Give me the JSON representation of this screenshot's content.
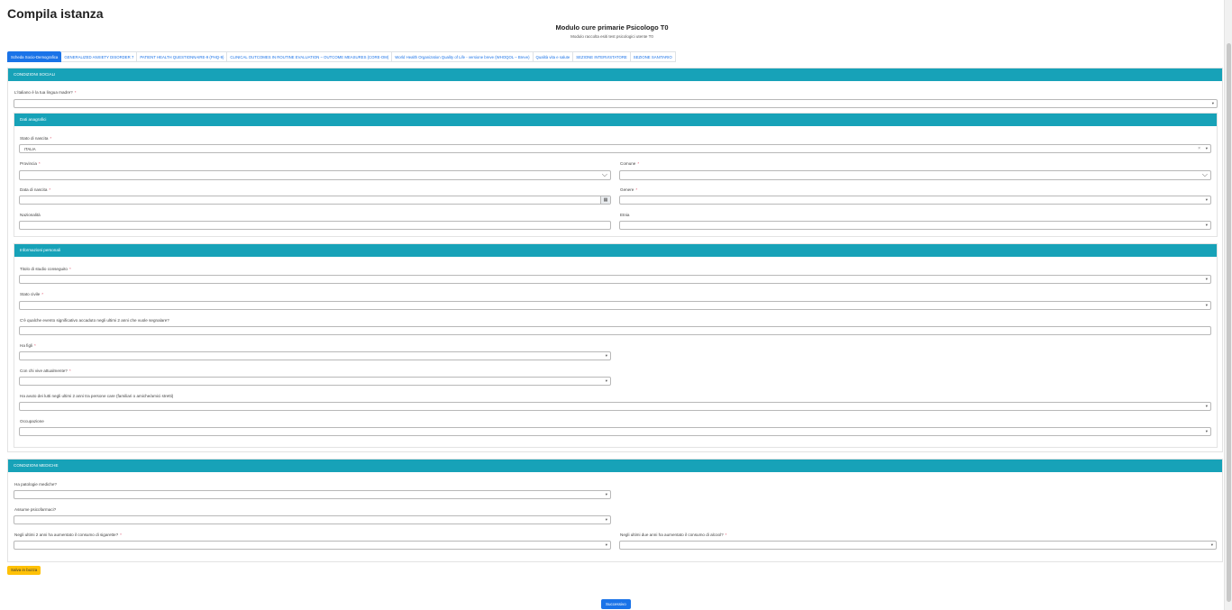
{
  "page": {
    "title": "Compila istanza",
    "form_title": "Modulo cure primarie Psicologo T0",
    "form_subtitle": "Modulo raccolta esiti test psicologici utente T0"
  },
  "tabs": [
    {
      "label": "Scheda Socio-Demografica",
      "active": true
    },
    {
      "label": "GENERALIZED ANXIETY DISORDER 7"
    },
    {
      "label": "PATIENT HEALTH QUESTIONNAIRE-9 (PHQ-9)"
    },
    {
      "label": "CLINICAL OUTCOMES IN ROUTINE EVALUATION – OUTCOME MEASURES (CORE-OM)"
    },
    {
      "label": "World Health Organization Quality of Life - versione breve (WHOQOL – Breve)"
    },
    {
      "label": "Qualità vita e salute"
    },
    {
      "label": "SEZIONE INTERVISTATORE"
    },
    {
      "label": "SEZIONE SANITARIO"
    }
  ],
  "social": {
    "header": "CONDIZIONI SOCIALI",
    "lingua_label": "L'italiano è la tua lingua madre?",
    "required_mark": "*",
    "anagrafici": {
      "header": "Dati anagrafici",
      "stato_nascita_label": "Stato di nascita",
      "stato_nascita_value": "ITALIA",
      "provincia_label": "Provincia",
      "comune_label": "Comune",
      "data_nascita_label": "Data di nascita",
      "genere_label": "Genere",
      "nazionalita_label": "Nazionalità",
      "etnia_label": "Etnia"
    },
    "personali": {
      "header": "Informazioni personali",
      "titolo_studio_label": "Titolo di studio conseguito",
      "stato_civile_label": "Stato civile",
      "evento_label": "C'è qualche evento significativo accaduto negli ultimi 2 anni che vuole segnalare?",
      "figli_label": "Ha figli",
      "vive_label": "Con chi vive attualmente?",
      "lutti_label": "Ha avuto dei lutti negli ultimi 2 anni tra persone care (familiari o amiche/amici stretti)",
      "occupazione_label": "Occupazione"
    }
  },
  "medical": {
    "header": "CONDIZIONI MEDICHE",
    "patologie_label": "Ha patologie mediche?",
    "psicofarmaci_label": "Assume psicofarmaci?",
    "sigarette_label": "Negli ultimi 2 anni ha aumentato il consumo di sigarette?",
    "alcool_label": "Negli ultimi due anni ha aumentato il consumo di alcool?"
  },
  "buttons": {
    "save": "Salva in bozza",
    "next": "Successivo"
  },
  "icons": {
    "caret": "▾",
    "chevron": "⌵",
    "clear": "×",
    "calendar": "▦"
  },
  "colors": {
    "header_teal": "#17a2b8",
    "primary_blue": "#1a73e8",
    "warning_yellow": "#ffc107",
    "required_red": "#e0566f"
  }
}
